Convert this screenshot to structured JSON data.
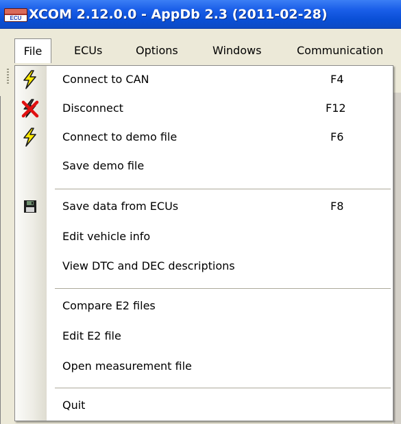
{
  "window": {
    "title": "XCOM 2.12.0.0 - AppDb 2.3 (2011-02-28)",
    "app_icon_text": "ECU"
  },
  "menubar": {
    "items": [
      {
        "label": "File",
        "open": true
      },
      {
        "label": "ECUs"
      },
      {
        "label": "Options"
      },
      {
        "label": "Windows"
      },
      {
        "label": "Communication"
      }
    ]
  },
  "file_menu": {
    "items": [
      {
        "label": "Connect to CAN",
        "shortcut": "F4",
        "icon": "lightning-bolt-icon"
      },
      {
        "label": "Disconnect",
        "shortcut": "F12",
        "icon": "disconnect-icon"
      },
      {
        "label": "Connect to demo file",
        "shortcut": "F6",
        "icon": "lightning-bolt-icon"
      },
      {
        "label": "Save demo file",
        "shortcut": ""
      },
      {
        "label": "Save data from ECUs",
        "shortcut": "F8",
        "icon": "floppy-disk-icon"
      },
      {
        "label": "Edit vehicle info",
        "shortcut": ""
      },
      {
        "label": "View DTC and DEC descriptions",
        "shortcut": ""
      },
      {
        "label": "Compare E2 files",
        "shortcut": ""
      },
      {
        "label": "Edit E2 file",
        "shortcut": ""
      },
      {
        "label": "Open measurement file",
        "shortcut": ""
      },
      {
        "label": "Quit",
        "shortcut": ""
      }
    ]
  },
  "colors": {
    "titlebar": "#0a4fd6",
    "menu_background": "#ffffff",
    "bolt_fill": "#ffea00",
    "disconnect_red": "#e01010"
  }
}
